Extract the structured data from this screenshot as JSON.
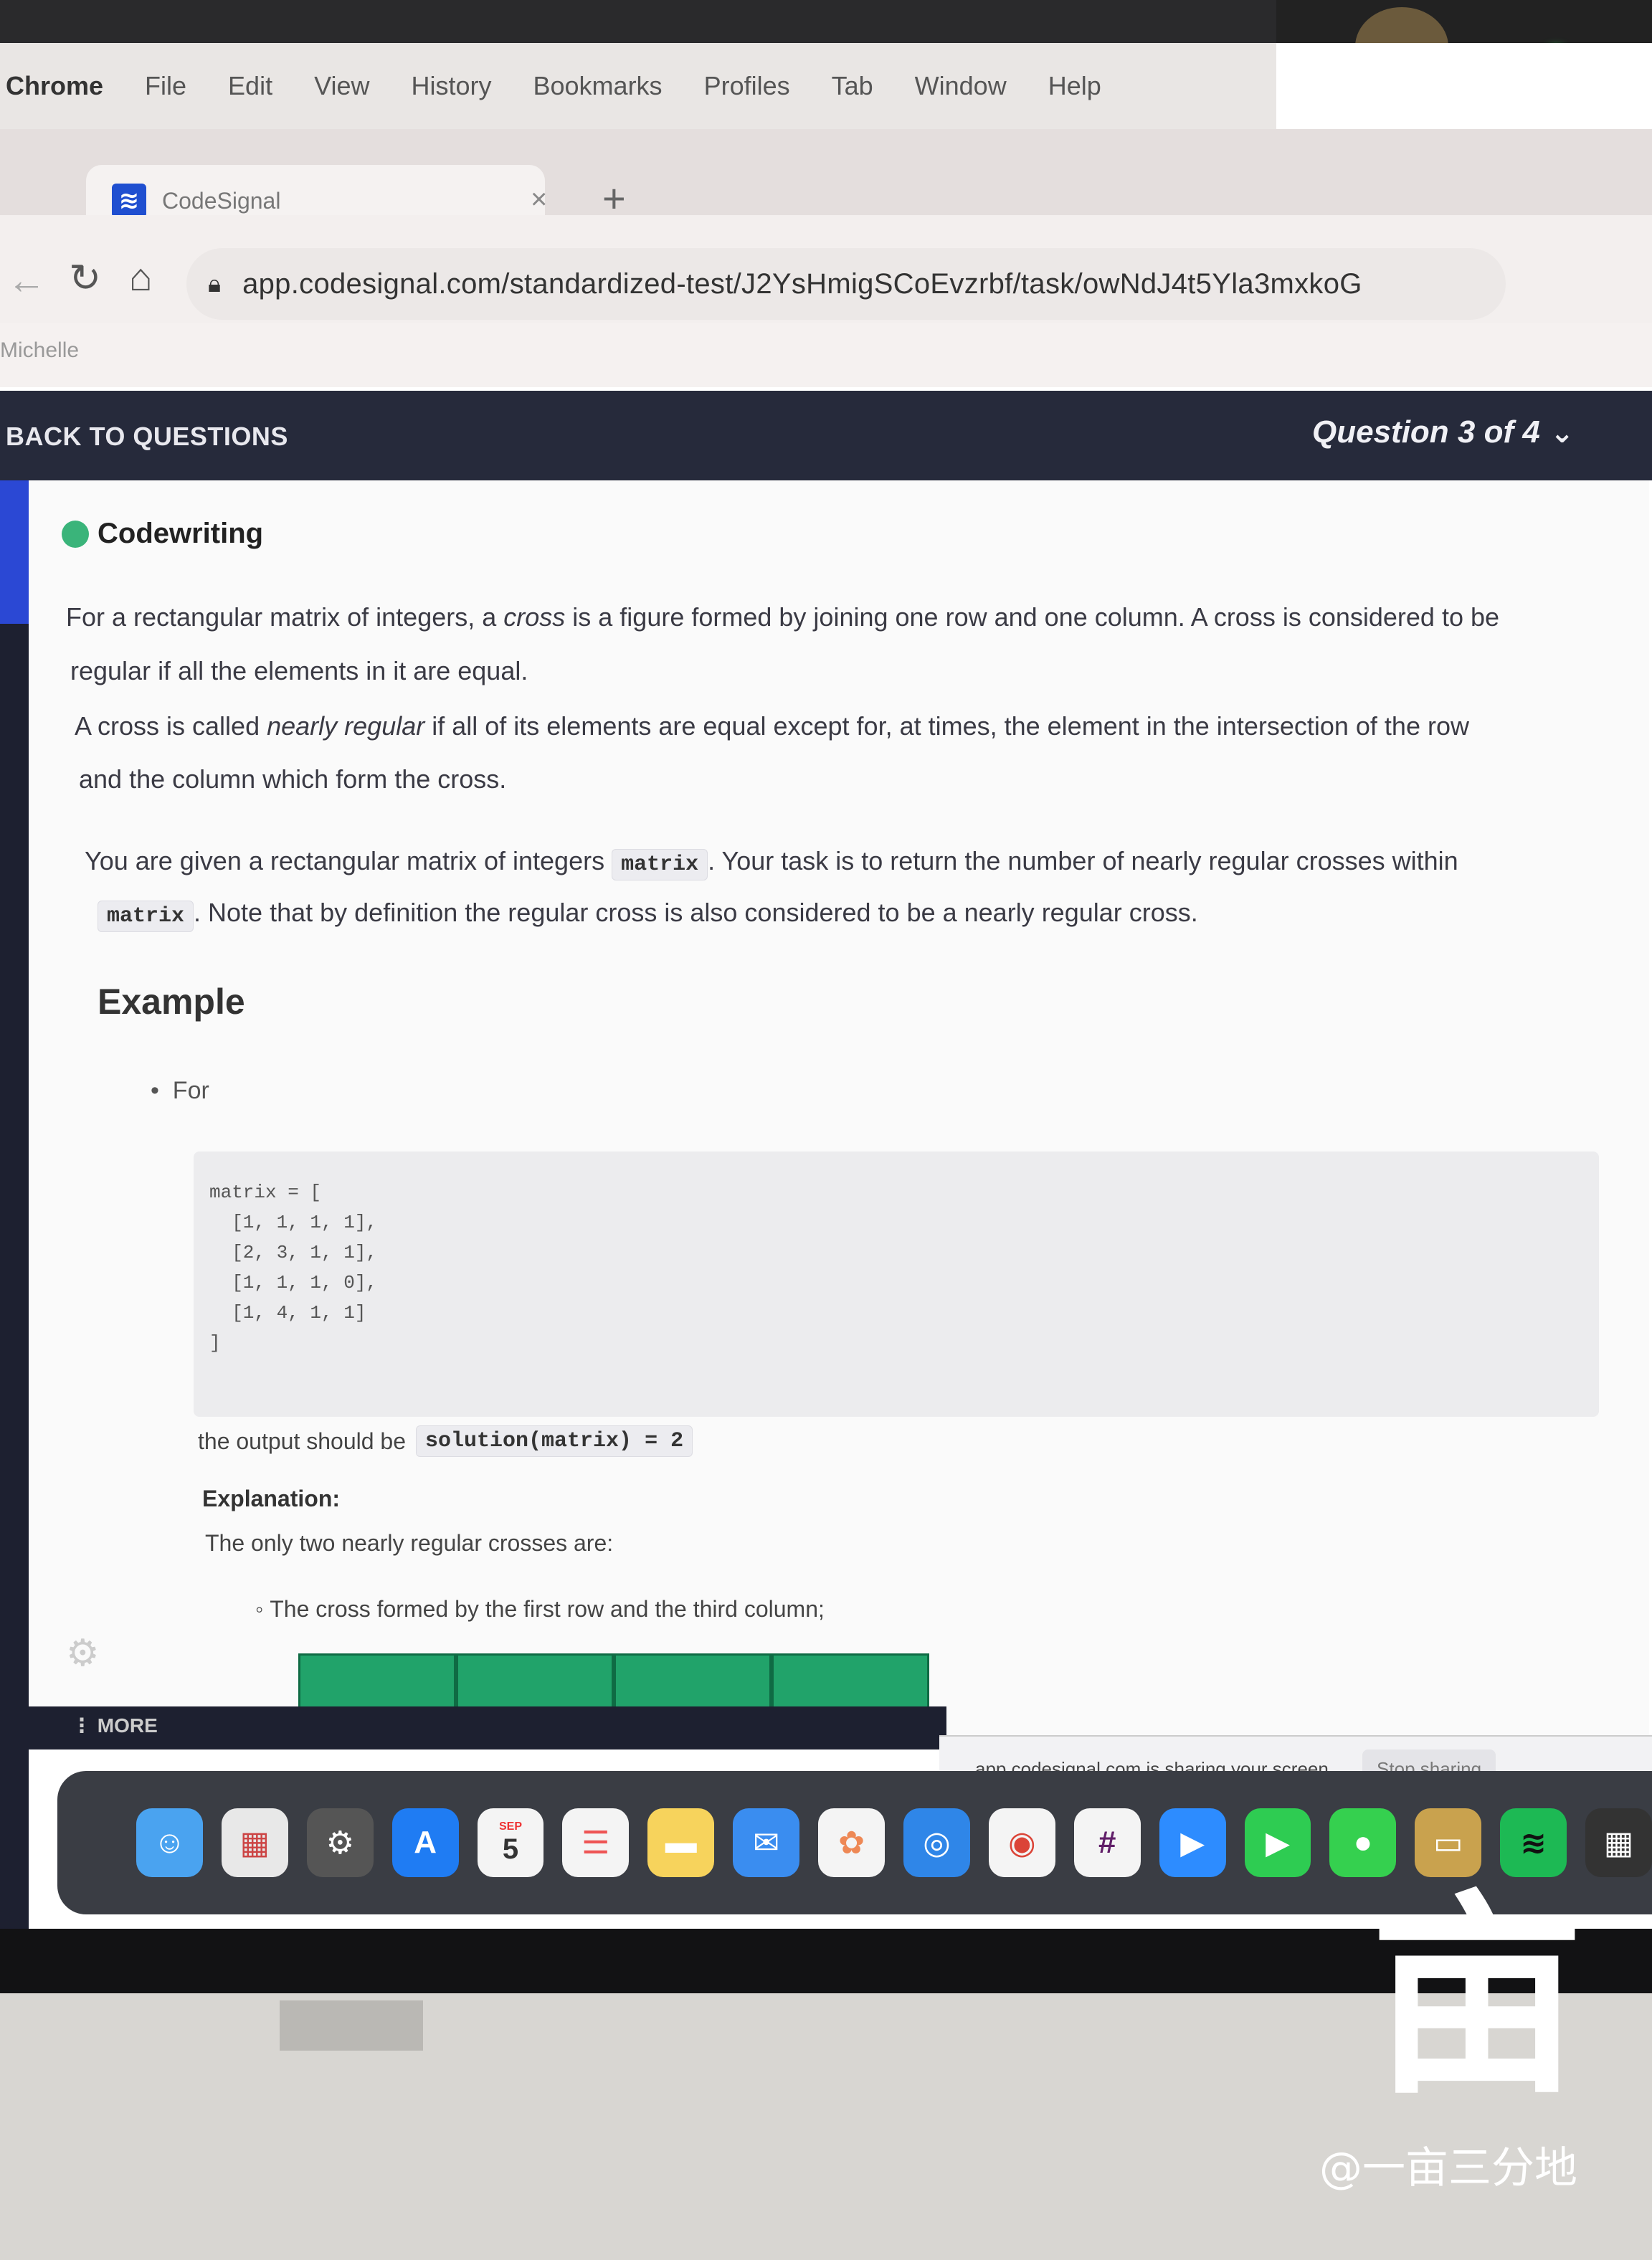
{
  "menubar": {
    "app": "Chrome",
    "items": [
      "File",
      "Edit",
      "View",
      "History",
      "Bookmarks",
      "Profiles",
      "Tab",
      "Window",
      "Help"
    ]
  },
  "tab": {
    "title": "CodeSignal",
    "favicon": "codesignal-icon"
  },
  "address_bar": {
    "url": "app.codesignal.com/standardized-test/J2YsHmigSCoEvzrbf/task/owNdJ4t5Yla3mxkoG"
  },
  "profile": "Michelle",
  "header": {
    "back_label": "BACK TO QUESTIONS",
    "question_counter": "Question 3 of 4"
  },
  "task": {
    "badge": "Codewriting",
    "p1_a": "For a rectangular matrix of integers, a ",
    "p1_em": "cross",
    "p1_b": " is a figure formed by joining one row and one column. A cross is considered to be",
    "p1_c": "regular if all the elements in it are equal.",
    "p2_a": "A cross is called ",
    "p2_em": "nearly regular",
    "p2_b": " if all of its elements are equal except for, at times, the element in the intersection of the row",
    "p2_c": "and the column which form the cross.",
    "p3_a": "You are given a rectangular matrix of integers",
    "p3_code": "matrix",
    "p3_b": ". Your task is to return the number of nearly regular crosses within",
    "p3_code2": "matrix",
    "p3_c": ". Note that by definition the regular cross is also considered to be a nearly regular cross.",
    "example_heading": "Example",
    "bullet": "For",
    "code_lines": [
      "matrix = [",
      "  [1, 1, 1, 1],",
      "  [2, 3, 1, 1],",
      "  [1, 1, 1, 0],",
      "  [1, 4, 1, 1]",
      "]"
    ],
    "output_prefix": "the output should be",
    "output_code": "solution(matrix) = 2",
    "explanation_heading": "Explanation:",
    "explanation_text": "The only two nearly regular crosses are:",
    "sub_bullet": "The cross formed by the first row and the third column;"
  },
  "sidebar": {
    "more_label": "MORE"
  },
  "sharing": {
    "text": "app.codesignal.com is sharing your screen.",
    "stop": "Stop sharing"
  },
  "dock": {
    "icons": [
      {
        "name": "finder-icon",
        "color": "#4aa3f0"
      },
      {
        "name": "launchpad-icon",
        "color": "#e8e8e8"
      },
      {
        "name": "system-preferences-icon",
        "color": "#555"
      },
      {
        "name": "app-store-icon",
        "color": "#1f7cf3"
      },
      {
        "name": "calendar-icon",
        "color": "#f4f4f4"
      },
      {
        "name": "reminders-icon",
        "color": "#f4f4f4"
      },
      {
        "name": "notes-icon",
        "color": "#f7d35c"
      },
      {
        "name": "mail-icon",
        "color": "#3a8df0"
      },
      {
        "name": "photos-icon",
        "color": "#f4f4f4"
      },
      {
        "name": "safari-icon",
        "color": "#2f86e8"
      },
      {
        "name": "chrome-icon",
        "color": "#f4f4f4"
      },
      {
        "name": "slack-icon",
        "color": "#f4f4f4"
      },
      {
        "name": "zoom-icon",
        "color": "#2d8cff"
      },
      {
        "name": "facetime-icon",
        "color": "#2ecc52"
      },
      {
        "name": "messages-icon",
        "color": "#35d04f"
      },
      {
        "name": "folder-icon",
        "color": "#c9a24e"
      },
      {
        "name": "spotify-icon",
        "color": "#1db954"
      },
      {
        "name": "calculator-icon",
        "color": "#333"
      }
    ],
    "calendar_month": "SEP",
    "calendar_day": "5"
  },
  "watermark": {
    "text": "@一亩三分地"
  }
}
